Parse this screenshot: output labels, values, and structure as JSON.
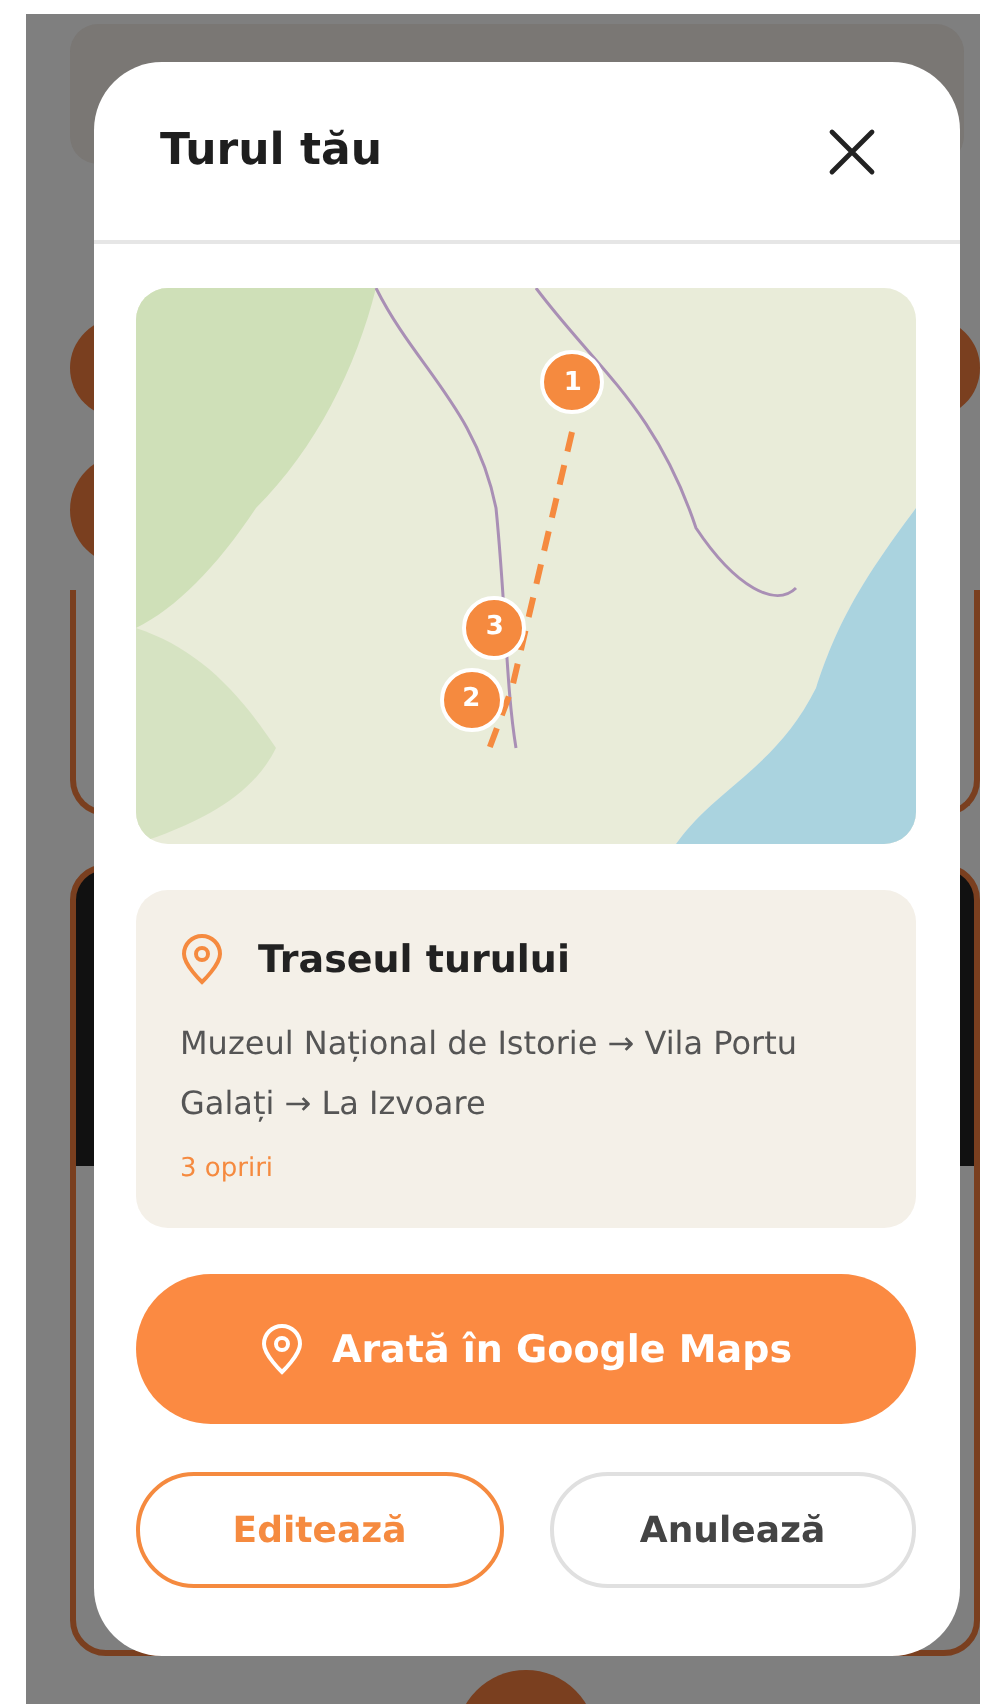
{
  "dialog": {
    "title": "Turul tău"
  },
  "map": {
    "markers": [
      {
        "label": "1"
      },
      {
        "label": "2"
      },
      {
        "label": "3"
      }
    ]
  },
  "route": {
    "title": "Traseul turului",
    "stops_text": "Muzeul Național de Istorie → Vila Portu Galați → La Izvoare",
    "count": "3 opriri"
  },
  "buttons": [
    {
      "label": "Arată în Google Maps",
      "kind": "primary"
    },
    {
      "label": "Editează",
      "kind": "outline"
    },
    {
      "label": "Anulează",
      "kind": "secondary"
    }
  ]
}
